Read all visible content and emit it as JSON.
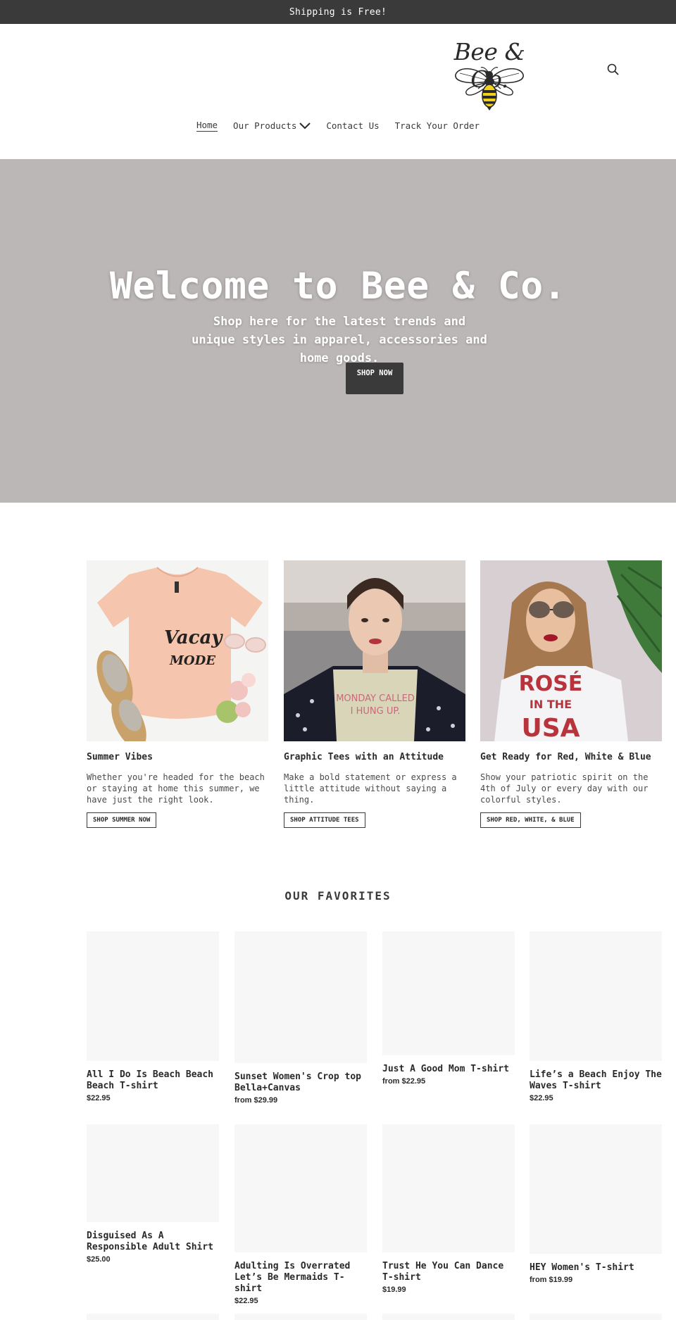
{
  "announcement": {
    "text": "Shipping is Free!"
  },
  "header": {
    "logo_text": "Bee & Co.",
    "logo_icon": "bee-icon",
    "search_icon": "search-icon"
  },
  "nav": {
    "items": [
      {
        "label": "Home",
        "active": true
      },
      {
        "label": "Our Products",
        "has_dropdown": true
      },
      {
        "label": "Contact Us"
      },
      {
        "label": "Track Your Order"
      }
    ]
  },
  "hero": {
    "title": "Welcome to Bee & Co.",
    "subtitle": "Shop here for the latest trends and unique styles in apparel, accessories and home goods.",
    "button_label": "SHOP NOW",
    "background_color": "#bcb7b7"
  },
  "features": [
    {
      "title": "Summer Vibes",
      "text": "Whether you're headed for the beach or staying at home this summer, we have just the right look.",
      "button": "SHOP SUMMER NOW",
      "shirt_text_1": "Vacay",
      "shirt_text_2": "MODE"
    },
    {
      "title": "Graphic Tees with an Attitude",
      "text": "Make a bold statement or express a little attitude without saying a thing.",
      "button": "SHOP ATTITUDE TEES",
      "shirt_text_1": "MONDAY CALLED",
      "shirt_text_2": "I HUNG UP."
    },
    {
      "title": "Get Ready for Red, White & Blue",
      "text": "Show your patriotic spirit on the 4th of July or every day with our colorful styles.",
      "button": "SHOP RED, WHITE, & BLUE",
      "shirt_text_1": "ROSÉ",
      "shirt_text_2": "IN THE",
      "shirt_text_3": "USA"
    }
  ],
  "favorites": {
    "title": "OUR FAVORITES",
    "products": [
      {
        "name": "All I Do Is Beach Beach Beach T-shirt",
        "price": "$22.95"
      },
      {
        "name": "Sunset Women's Crop top Bella+Canvas",
        "price": "from $29.99"
      },
      {
        "name": "Just A Good Mom T-shirt",
        "price": "from $22.95"
      },
      {
        "name": "Life’s a Beach Enjoy The Waves T-shirt",
        "price": "$22.95"
      },
      {
        "name": "Disguised As A Responsible Adult Shirt",
        "price": "$25.00"
      },
      {
        "name": "Adulting Is Overrated Let’s Be Mermaids T-shirt",
        "price": "$22.95"
      },
      {
        "name": "Trust He You Can Dance T-shirt",
        "price": "$19.99"
      },
      {
        "name": "HEY Women's T-shirt",
        "price": "from $19.99"
      }
    ]
  }
}
